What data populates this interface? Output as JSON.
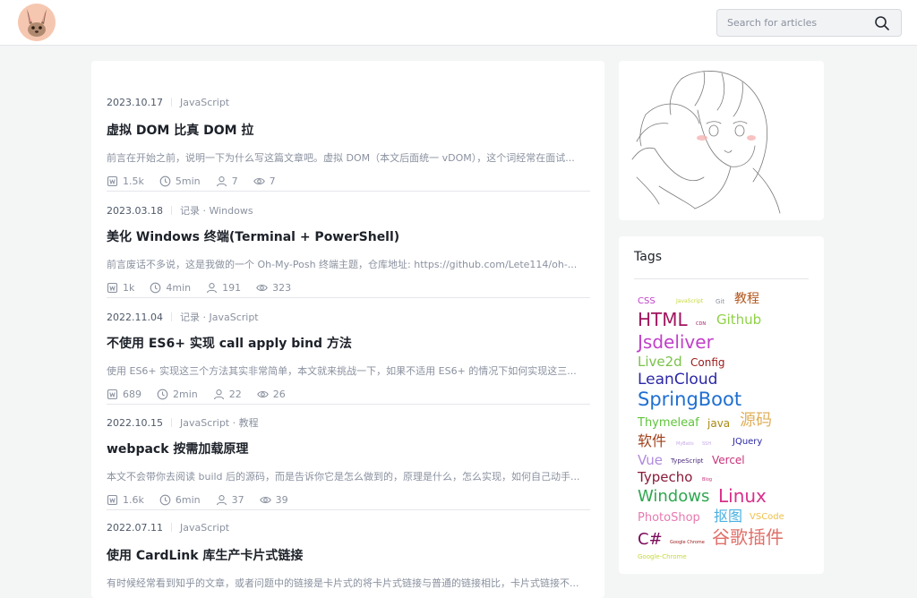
{
  "header": {
    "search_placeholder": "Search for articles"
  },
  "articles": [
    {
      "date": "2023.10.17",
      "category": "JavaScript",
      "title": "虚拟 DOM 比真 DOM 拉",
      "excerpt": "前言在开始之前，说明一下为什么写这篇文章吧。虚拟 DOM（本文后面统一 vDOM），这个词经常在面试...",
      "words": "1.5k",
      "time": "5min",
      "visitors": "7",
      "views": "7"
    },
    {
      "date": "2023.03.18",
      "category": "记录 · Windows",
      "title": "美化 Windows 终端(Terminal + PowerShell)",
      "excerpt": "前言废话不多说，这是我做的一个 Oh-My-Posh 终端主题，仓库地址: https://github.com/Lete114/oh-...",
      "words": "1k",
      "time": "4min",
      "visitors": "191",
      "views": "323"
    },
    {
      "date": "2022.11.04",
      "category": "记录 · JavaScript",
      "title": "不使用 ES6+ 实现 call apply bind 方法",
      "excerpt": "使用 ES6+ 实现这三个方法其实非常简单，本文就来挑战一下，如果不适用 ES6+ 的情况下如何实现这三...",
      "words": "689",
      "time": "2min",
      "visitors": "22",
      "views": "26"
    },
    {
      "date": "2022.10.15",
      "category": "JavaScript · 教程",
      "title": "webpack 按需加载原理",
      "excerpt": "本文不会带你去阅读 build 后的源码，而是告诉你它是怎么做到的，原理是什么，怎么实现，如何自己动手...",
      "words": "1.6k",
      "time": "6min",
      "visitors": "37",
      "views": "39"
    },
    {
      "date": "2022.07.11",
      "category": "JavaScript",
      "title": "使用 CardLink 库生产卡片式链接",
      "excerpt": "有时候经常看到知乎的文章，或者问题中的链接是卡片式的将卡片式链接与普通的链接相比，卡片式链接不...",
      "words": "",
      "time": "",
      "visitors": "",
      "views": ""
    }
  ],
  "sidebar": {
    "tags_title": "Tags",
    "tags": [
      {
        "text": "CSS",
        "color": "#c13fc9"
      },
      {
        "text": "JavaScript",
        "color": "#c8d83a"
      },
      {
        "text": "Git",
        "color": "#8a919f"
      },
      {
        "text": "教程",
        "color": "#b2561c"
      },
      {
        "text": "HTML",
        "color": "#a0155f"
      },
      {
        "text": "CDN",
        "color": "#a0155f"
      },
      {
        "text": "Github",
        "color": "#8fd146"
      },
      {
        "text": "Jsdeliver",
        "color": "#c13fc9"
      },
      {
        "text": "Live2d",
        "color": "#7ac24a"
      },
      {
        "text": "Config",
        "color": "#9a1818"
      },
      {
        "text": "LeanCloud",
        "color": "#2b27a6"
      },
      {
        "text": "SpringBoot",
        "color": "#1f6fd1"
      },
      {
        "text": "Thymeleaf",
        "color": "#5fc43a"
      },
      {
        "text": "java",
        "color": "#a88a12"
      },
      {
        "text": "源码",
        "color": "#e0b05c"
      },
      {
        "text": "软件",
        "color": "#a0401a"
      },
      {
        "text": "MyBatis",
        "color": "#c8a8e8"
      },
      {
        "text": "SSH",
        "color": "#c8a8e8"
      },
      {
        "text": "JQuery",
        "color": "#2b27a6"
      },
      {
        "text": "Vue",
        "color": "#b08ae0"
      },
      {
        "text": "TypeScript",
        "color": "#4a2a7a"
      },
      {
        "text": "Vercel",
        "color": "#c9317a"
      },
      {
        "text": "Typecho",
        "color": "#8a1a3a"
      },
      {
        "text": "Blog",
        "color": "#c9317a"
      },
      {
        "text": "Windows",
        "color": "#2ea84f"
      },
      {
        "text": "Linux",
        "color": "#d92f8a"
      },
      {
        "text": "PhotoShop",
        "color": "#e77ab0"
      },
      {
        "text": "抠图",
        "color": "#4ab0e0"
      },
      {
        "text": "VSCode",
        "color": "#f0c04a"
      },
      {
        "text": "C#",
        "color": "#7a0a5a"
      },
      {
        "text": "Google Chrome",
        "color": "#9a1818"
      },
      {
        "text": "谷歌插件",
        "color": "#e0706a"
      },
      {
        "text": "Google-Chrome",
        "color": "#c8d83a"
      }
    ]
  }
}
